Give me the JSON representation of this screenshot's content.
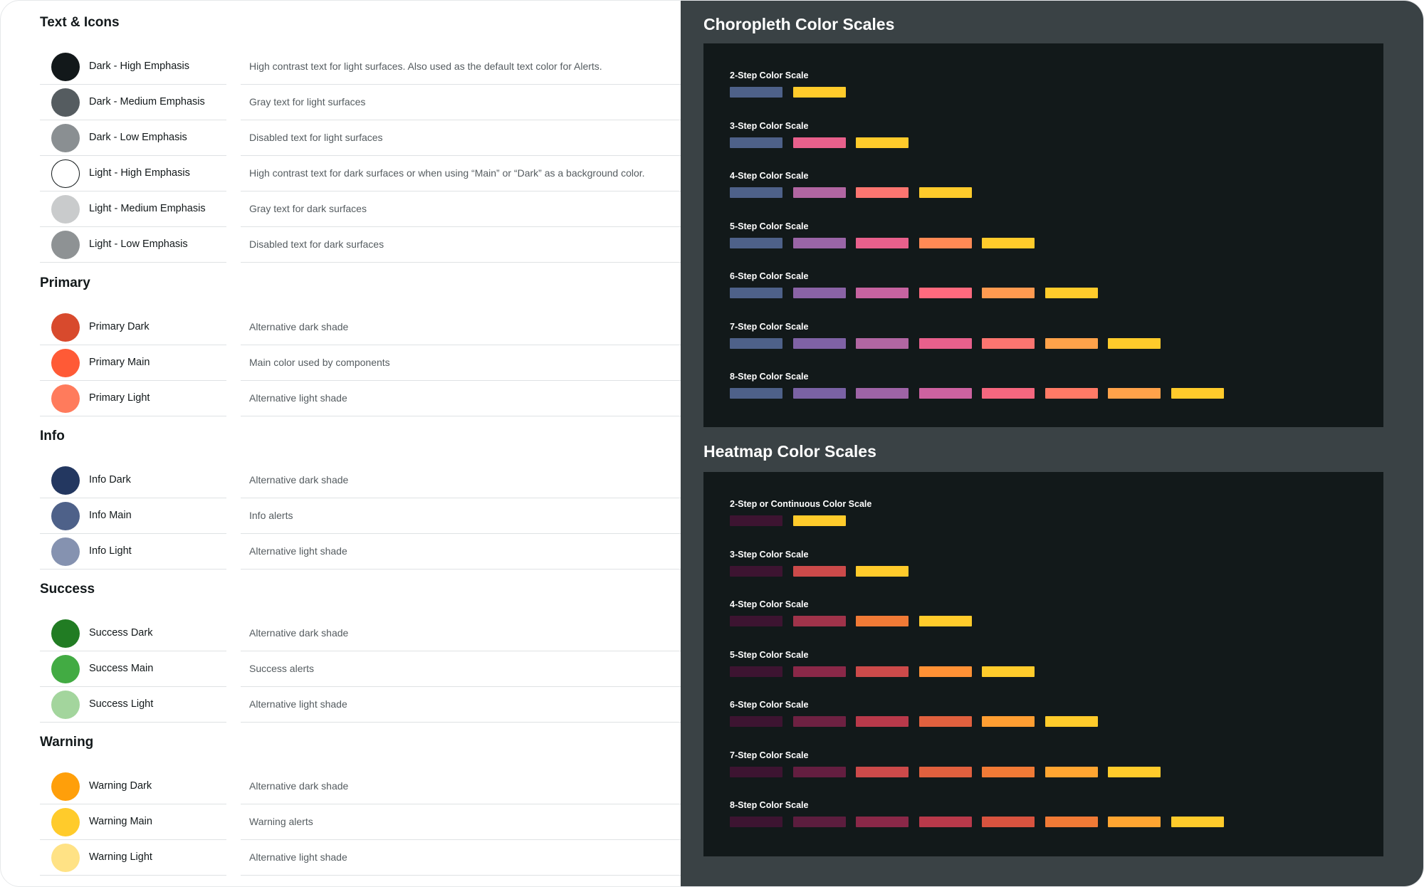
{
  "left_groups": [
    {
      "title": "Text & Icons",
      "items": [
        {
          "name": "Dark - High Emphasis",
          "color": "#12181a",
          "outlined": false,
          "desc": "High contrast text for light surfaces. Also used as the default text color for Alerts."
        },
        {
          "name": "Dark - Medium Emphasis",
          "color": "#555c60",
          "outlined": false,
          "desc": "Gray text for light surfaces"
        },
        {
          "name": "Dark - Low Emphasis",
          "color": "#8a8f92",
          "outlined": false,
          "desc": "Disabled text for light surfaces"
        },
        {
          "name": "Light - High Emphasis",
          "color": "#ffffff",
          "outlined": true,
          "desc": "High contrast text for dark surfaces or when using “Main” or “Dark” as a background color."
        },
        {
          "name": "Light - Medium Emphasis",
          "color": "#c9cbcc",
          "outlined": false,
          "desc": "Gray text for dark surfaces"
        },
        {
          "name": "Light - Low Emphasis",
          "color": "#8e9294",
          "outlined": false,
          "desc": "Disabled text for dark surfaces"
        }
      ]
    },
    {
      "title": "Primary",
      "items": [
        {
          "name": "Primary Dark",
          "color": "#d84a2d",
          "outlined": false,
          "desc": "Alternative dark shade"
        },
        {
          "name": "Primary Main",
          "color": "#ff5a36",
          "outlined": false,
          "desc": "Main color used by components"
        },
        {
          "name": "Primary Light",
          "color": "#ff7b5c",
          "outlined": false,
          "desc": "Alternative light shade"
        }
      ]
    },
    {
      "title": "Info",
      "items": [
        {
          "name": "Info Dark",
          "color": "#233760",
          "outlined": false,
          "desc": "Alternative dark shade"
        },
        {
          "name": "Info Main",
          "color": "#4e6189",
          "outlined": false,
          "desc": "Info alerts"
        },
        {
          "name": "Info Light",
          "color": "#8592b0",
          "outlined": false,
          "desc": "Alternative light shade"
        }
      ]
    },
    {
      "title": "Success",
      "items": [
        {
          "name": "Success Dark",
          "color": "#217c23",
          "outlined": false,
          "desc": "Alternative dark shade"
        },
        {
          "name": "Success Main",
          "color": "#42ab43",
          "outlined": false,
          "desc": "Success alerts"
        },
        {
          "name": "Success Light",
          "color": "#a3d59d",
          "outlined": false,
          "desc": "Alternative light shade"
        }
      ]
    },
    {
      "title": "Warning",
      "items": [
        {
          "name": "Warning Dark",
          "color": "#ff9f0a",
          "outlined": false,
          "desc": "Alternative dark shade"
        },
        {
          "name": "Warning Main",
          "color": "#ffcb2b",
          "outlined": false,
          "desc": "Warning alerts"
        },
        {
          "name": "Warning Light",
          "color": "#ffe285",
          "outlined": false,
          "desc": "Alternative light shade"
        }
      ]
    }
  ],
  "choropleth": {
    "title": "Choropleth Color Scales",
    "scales": [
      {
        "label": "2-Step Color Scale",
        "colors": [
          "#4e6189",
          "#ffcb2b"
        ]
      },
      {
        "label": "3-Step Color Scale",
        "colors": [
          "#4e6189",
          "#e8608c",
          "#ffcb2b"
        ]
      },
      {
        "label": "4-Step Color Scale",
        "colors": [
          "#4e6189",
          "#b166a2",
          "#fb7570",
          "#ffcb2b"
        ]
      },
      {
        "label": "5-Step Color Scale",
        "colors": [
          "#4e6189",
          "#9a65a7",
          "#e8608c",
          "#ff8a55",
          "#ffcb2b"
        ]
      },
      {
        "label": "6-Step Color Scale",
        "colors": [
          "#4e6189",
          "#8a63a6",
          "#c663a0",
          "#ff6a7e",
          "#ff9a50",
          "#ffcb2b"
        ]
      },
      {
        "label": "7-Step Color Scale",
        "colors": [
          "#4e6189",
          "#7f62a5",
          "#b166a2",
          "#e8608c",
          "#fb7570",
          "#ffa24a",
          "#ffcb2b"
        ]
      },
      {
        "label": "8-Step Color Scale",
        "colors": [
          "#4e6189",
          "#7a62a4",
          "#9e64a6",
          "#cd62a0",
          "#f5677f",
          "#ff7a66",
          "#ffa24a",
          "#ffcb2b"
        ]
      }
    ]
  },
  "heatmap": {
    "title": "Heatmap Color Scales",
    "scales": [
      {
        "label": "2-Step or Continuous Color Scale",
        "colors": [
          "#3d1431",
          "#ffcb2b"
        ]
      },
      {
        "label": "3-Step Color Scale",
        "colors": [
          "#3d1431",
          "#cc4a4a",
          "#ffcb2b"
        ]
      },
      {
        "label": "4-Step Color Scale",
        "colors": [
          "#3d1431",
          "#a0334a",
          "#f07a36",
          "#ffcb2b"
        ]
      },
      {
        "label": "5-Step Color Scale",
        "colors": [
          "#3d1431",
          "#8a2848",
          "#cc4a4a",
          "#ff9135",
          "#ffcb2b"
        ]
      },
      {
        "label": "6-Step Color Scale",
        "colors": [
          "#3d1431",
          "#6e2142",
          "#b8394a",
          "#e0603e",
          "#ff9e32",
          "#ffcb2b"
        ]
      },
      {
        "label": "7-Step Color Scale",
        "colors": [
          "#3d1431",
          "#641e40",
          "#cc4a4a",
          "#e0603e",
          "#f07a36",
          "#ffa531",
          "#ffcb2b"
        ]
      },
      {
        "label": "8-Step Color Scale",
        "colors": [
          "#3d1431",
          "#5c1d3e",
          "#8a2848",
          "#b8394a",
          "#d8533f",
          "#f07a36",
          "#ffa531",
          "#ffcb2b"
        ]
      }
    ]
  }
}
